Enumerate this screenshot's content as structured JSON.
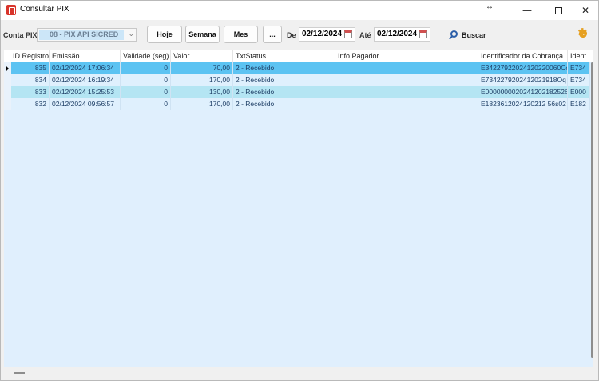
{
  "window": {
    "title": "Consultar PIX",
    "resize_glyph": "↔",
    "min_glyph": "—",
    "close_glyph": "✕"
  },
  "toolbar": {
    "conta_label": "Conta PIX",
    "conta_value": "08 - PIX API SICRED",
    "combo_arrow": "⌄",
    "hoje_label": "Hoje",
    "semana_label": "Semana",
    "mes_label": "Mes",
    "more_label": "...",
    "de_label": "De",
    "de_value": "02/12/2024",
    "ate_label": "Até",
    "ate_value": "02/12/2024",
    "buscar_label": "Buscar"
  },
  "grid": {
    "columns": [
      "ID Registro",
      "Emissão",
      "Validade (seg)",
      "Valor",
      "TxtStatus",
      "Info Pagador",
      "Identificador da Cobrança",
      "Ident"
    ],
    "rows": [
      {
        "id": "835",
        "emissao": "02/12/2024 17:06:34",
        "validade": "0",
        "valor": "70,00",
        "status": "2 - Recebido",
        "info": "",
        "identificador": "E34227922024120220060Cc",
        "ident": "E734",
        "bg": "#5cc3f2"
      },
      {
        "id": "834",
        "emissao": "02/12/2024 16:19:34",
        "validade": "0",
        "valor": "170,00",
        "status": "2 - Recebido",
        "info": "",
        "identificador": "E7342279202412021918Oq",
        "ident": "E734",
        "bg": "#dff0fd"
      },
      {
        "id": "833",
        "emissao": "02/12/2024 15:25:53",
        "validade": "0",
        "valor": "130,00",
        "status": "2 - Recebido",
        "info": "",
        "identificador": "E000000002024120218252​61",
        "ident": "E000",
        "bg": "#b4e5f3"
      },
      {
        "id": "832",
        "emissao": "02/12/2024 09:56:57",
        "validade": "0",
        "valor": "170,00",
        "status": "2 - Recebido",
        "info": "",
        "identificador": "E1823612024120212 56s02",
        "ident": "E182",
        "bg": "#dff0fd"
      }
    ]
  },
  "colors": {
    "selected_row": "#5cc3f2",
    "alt_row": "#b4e5f3",
    "grid_bg": "#e0effd"
  }
}
